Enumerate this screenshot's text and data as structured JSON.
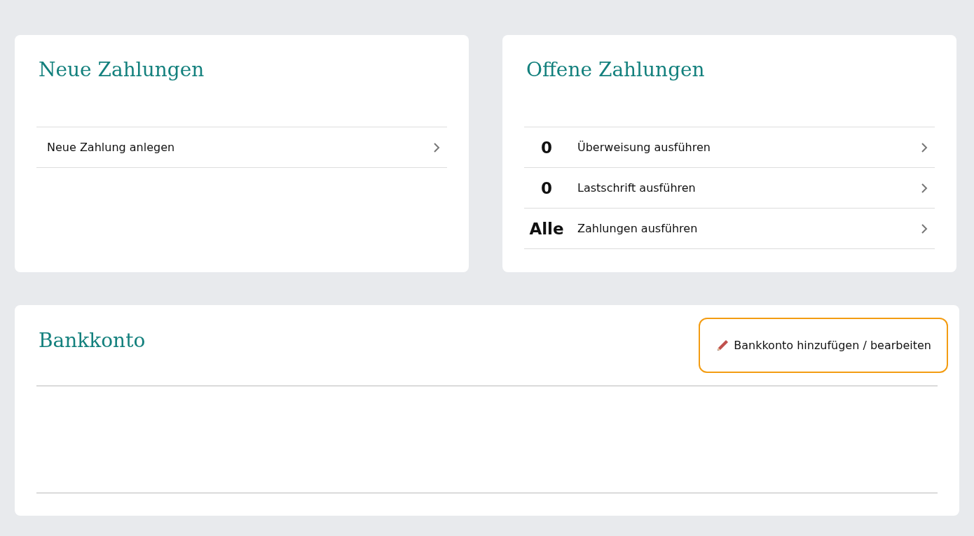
{
  "new_payments": {
    "title": "Neue Zahlungen",
    "items": [
      {
        "label": "Neue Zahlung anlegen"
      }
    ]
  },
  "open_payments": {
    "title": "Offene Zahlungen",
    "items": [
      {
        "count": "0",
        "label": "Überweisung ausführen"
      },
      {
        "count": "0",
        "label": "Lastschrift ausführen"
      },
      {
        "count": "Alle",
        "label": "Zahlungen ausführen"
      }
    ]
  },
  "bank_account": {
    "title": "Bankkonto",
    "button": {
      "label": "Bankkonto hinzufügen / bearbeiten",
      "focused": true
    }
  }
}
